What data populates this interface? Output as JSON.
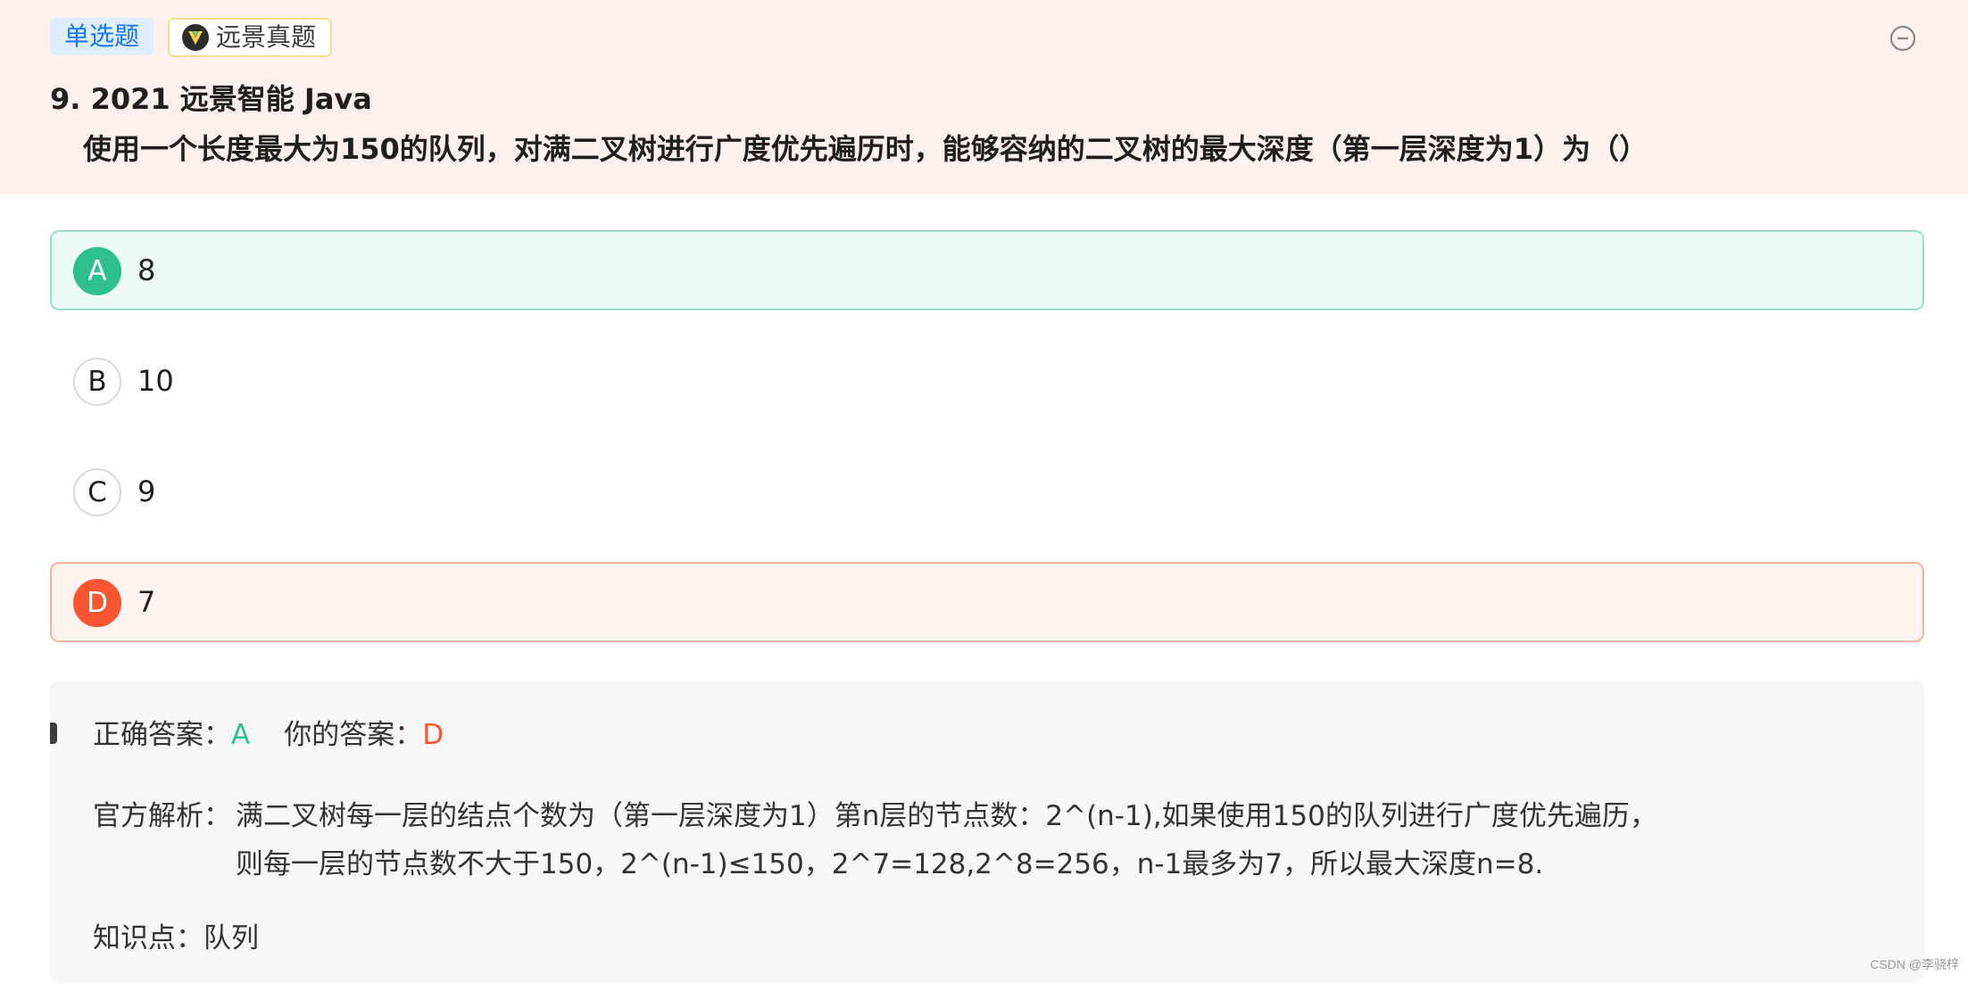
{
  "header": {
    "type_tag": "单选题",
    "source_tag": "远景真题",
    "title": "9. 2021 远景智能 Java",
    "question": "使用一个长度最大为150的队列，对满二叉树进行广度优先遍历时，能够容纳的二叉树的最大深度（第一层深度为1）为（）"
  },
  "options": [
    {
      "letter": "A",
      "text": "8",
      "state": "correct"
    },
    {
      "letter": "B",
      "text": "10",
      "state": "neutral"
    },
    {
      "letter": "C",
      "text": "9",
      "state": "neutral"
    },
    {
      "letter": "D",
      "text": "7",
      "state": "wrong"
    }
  ],
  "analysis": {
    "correct_label": "正确答案：",
    "correct_value": "A",
    "yours_label": "你的答案：",
    "yours_value": "D",
    "explanation_label": "官方解析：",
    "explanation_lines": [
      "满二叉树每一层的结点个数为（第一层深度为1）第n层的节点数：2^(n-1),如果使用150的队列进行广度优先遍历，",
      "则每一层的节点数不大于150，2^(n-1)≤150，2^7=128,2^8=256，n-1最多为7，所以最大深度n=8."
    ],
    "knowledge_label": "知识点：",
    "knowledge_value": "队列"
  },
  "watermark": "CSDN @李骁梓",
  "colors": {
    "header_bg": "#fff1ee",
    "correct": "#2dc08e",
    "wrong": "#fc5531",
    "tag_blue": "#1677ff"
  }
}
